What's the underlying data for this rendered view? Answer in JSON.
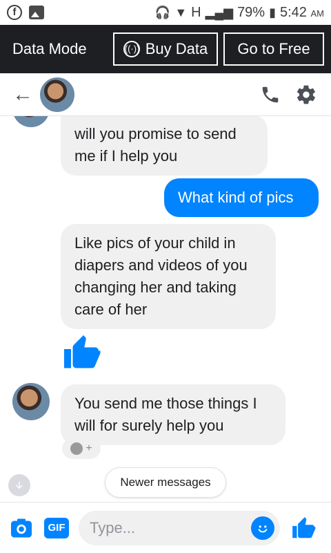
{
  "status_bar": {
    "battery": "79%",
    "network": "H",
    "time": "5:42",
    "ampm": "AM"
  },
  "data_bar": {
    "label": "Data Mode",
    "buy_label": "Buy Data",
    "free_label": "Go to Free"
  },
  "composer": {
    "placeholder": "Type...",
    "gif_label": "GIF"
  },
  "thread": {
    "newer_label": "Newer messages",
    "messages": [
      {
        "from": "them",
        "text": "will you promise to send me if I help you"
      },
      {
        "from": "me",
        "text": "What kind of pics"
      },
      {
        "from": "them",
        "text": "Like pics of your child in diapers and videos of you changing her and taking care of her"
      },
      {
        "from": "me",
        "type": "like"
      },
      {
        "from": "them",
        "text": "You send me those things I will for surely help you"
      }
    ]
  },
  "colors": {
    "accent": "#0084ff",
    "bar_dark": "#1d1f23",
    "bubble_in": "#f1f0f0"
  }
}
